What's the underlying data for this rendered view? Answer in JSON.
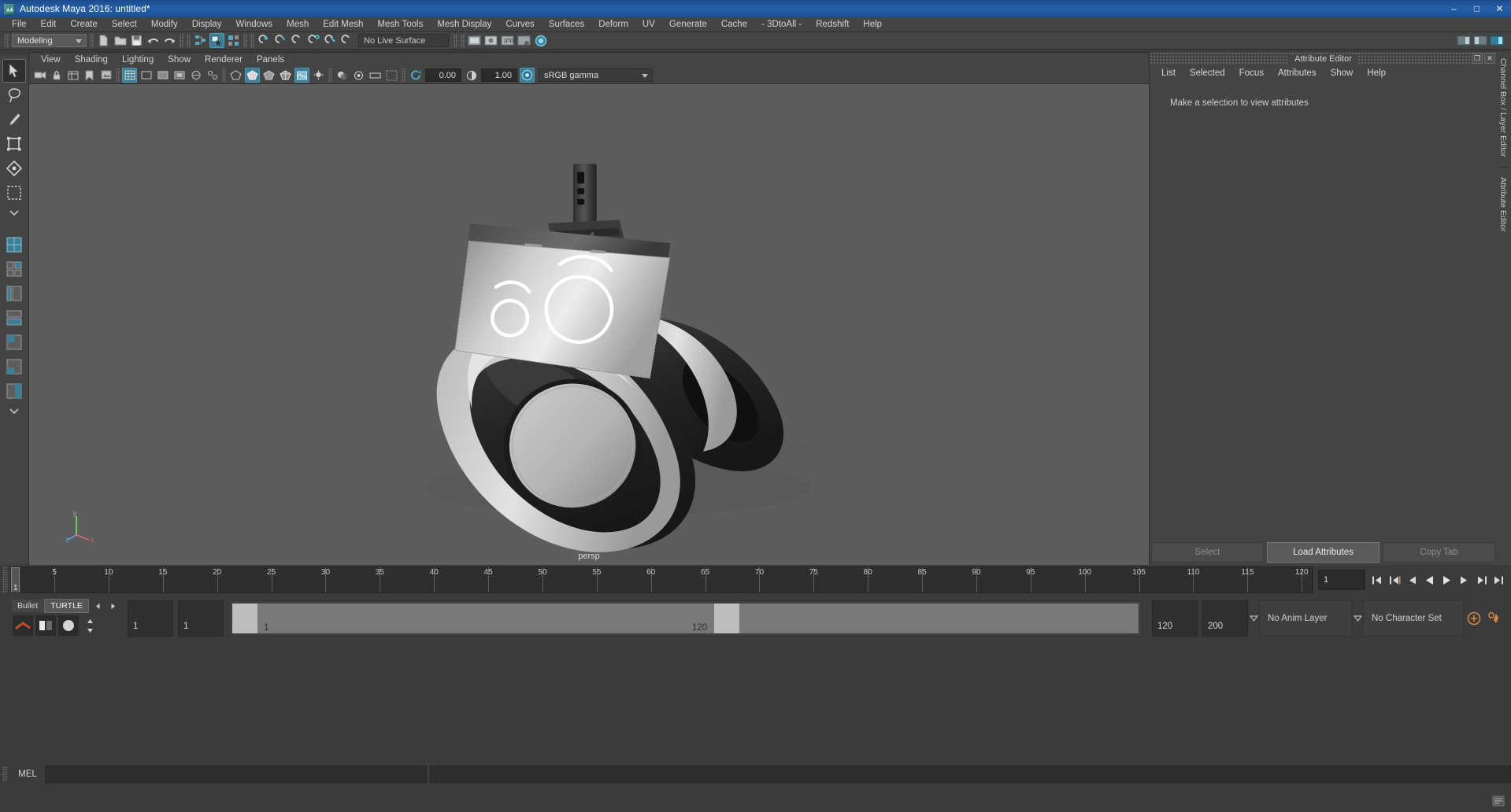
{
  "window": {
    "title": "Autodesk Maya 2016: untitled*",
    "icon": "maya-icon",
    "minimize": "–",
    "maximize": "□",
    "close": "✕"
  },
  "menubar": {
    "items": [
      {
        "label": "File"
      },
      {
        "label": "Edit"
      },
      {
        "label": "Create"
      },
      {
        "label": "Select"
      },
      {
        "label": "Modify"
      },
      {
        "label": "Display"
      },
      {
        "label": "Windows"
      },
      {
        "label": "Mesh"
      },
      {
        "label": "Edit Mesh"
      },
      {
        "label": "Mesh Tools"
      },
      {
        "label": "Mesh Display"
      },
      {
        "label": "Curves"
      },
      {
        "label": "Surfaces"
      },
      {
        "label": "Deform"
      },
      {
        "label": "UV"
      },
      {
        "label": "Generate"
      },
      {
        "label": "Cache"
      },
      {
        "label": "- 3DtoAll -"
      },
      {
        "label": "Redshift"
      },
      {
        "label": "Help"
      }
    ]
  },
  "statusbar": {
    "menu_set": "Modeling",
    "live_surface": "No Live Surface",
    "icons": [
      "new-scene-icon",
      "open-scene-icon",
      "save-scene-icon",
      "undo-icon",
      "redo-icon",
      "select-by-hierarchy-icon",
      "select-by-object-icon",
      "select-by-component-icon",
      "snap-to-grid-icon",
      "snap-to-curve-icon",
      "snap-to-point-icon",
      "snap-to-projected-center-icon",
      "snap-to-view-plane-icon",
      "make-live-icon",
      "show-hide-render-view-icon",
      "render-current-frame-icon",
      "ipr-render-icon",
      "render-settings-icon",
      "hypershade-icon"
    ],
    "right_icons": [
      "sidebar-attribute-editor-icon",
      "sidebar-tool-settings-icon",
      "sidebar-channel-box-icon"
    ]
  },
  "toolbox": {
    "tools": [
      {
        "name": "select-tool",
        "selected": true
      },
      {
        "name": "lasso-select-tool",
        "selected": false
      },
      {
        "name": "paint-select-tool",
        "selected": false
      },
      {
        "name": "move-tool",
        "selected": false
      },
      {
        "name": "rotate-tool",
        "selected": false
      },
      {
        "name": "scale-tool",
        "selected": false
      },
      {
        "name": "last-tool-used",
        "selected": false
      }
    ],
    "layouts": [
      {
        "name": "single-perspective-view-layout"
      },
      {
        "name": "four-view-layout"
      },
      {
        "name": "persp-outliner-layout"
      },
      {
        "name": "persp-graph-editor-layout"
      },
      {
        "name": "hypershade-persp-layout"
      },
      {
        "name": "persp-uv-editor-layout"
      },
      {
        "name": "more-layouts"
      }
    ]
  },
  "viewport": {
    "menus": [
      {
        "label": "View"
      },
      {
        "label": "Shading"
      },
      {
        "label": "Lighting"
      },
      {
        "label": "Show"
      },
      {
        "label": "Renderer"
      },
      {
        "label": "Panels"
      }
    ],
    "exposure": "0.00",
    "gamma": "1.00",
    "color_management": "sRGB gamma",
    "camera_label": "persp",
    "axis_labels": {
      "x": "x",
      "y": "y",
      "z": "z"
    },
    "background_top": "#5f5f5f",
    "background_bottom": "#5a5a5a"
  },
  "attribute_editor": {
    "title": "Attribute Editor",
    "window_buttons": [
      "undock-icon",
      "close-icon"
    ],
    "menus": [
      {
        "label": "List"
      },
      {
        "label": "Selected"
      },
      {
        "label": "Focus"
      },
      {
        "label": "Attributes"
      },
      {
        "label": "Show"
      },
      {
        "label": "Help"
      }
    ],
    "empty_message": "Make a selection to view attributes",
    "footer": [
      {
        "label": "Select",
        "active": false
      },
      {
        "label": "Load Attributes",
        "active": true
      },
      {
        "label": "Copy Tab",
        "active": false
      }
    ]
  },
  "right_tabs": [
    {
      "label": "Channel Box / Layer Editor"
    },
    {
      "label": "Attribute Editor"
    }
  ],
  "timeline": {
    "ticks": [
      5,
      10,
      15,
      20,
      25,
      30,
      35,
      40,
      45,
      50,
      55,
      60,
      65,
      70,
      75,
      80,
      85,
      90,
      95,
      100,
      105,
      110,
      115,
      120
    ],
    "current_frame": "1",
    "current_frame_field": "1",
    "playback_buttons": [
      "go-to-start-icon",
      "step-back-keyframe-icon",
      "step-back-frame-icon",
      "play-backwards-icon",
      "play-forwards-icon",
      "step-forward-frame-icon",
      "step-forward-keyframe-icon",
      "go-to-end-icon"
    ]
  },
  "range_slider": {
    "shelf_tabs": [
      {
        "label": "Bullet",
        "active": false
      },
      {
        "label": "TURTLE",
        "active": true
      }
    ],
    "anim_start": "1",
    "anim_end": "1",
    "range_start": "1",
    "range_end": "120",
    "playback_end": "120",
    "anim_end_total": "200",
    "anim_layer": "No Anim Layer",
    "character_set": "No Character Set",
    "right_icons": [
      "auto-key-icon",
      "animation-preferences-icon"
    ]
  },
  "command_line": {
    "label": "MEL",
    "input_value": "",
    "output_value": ""
  }
}
